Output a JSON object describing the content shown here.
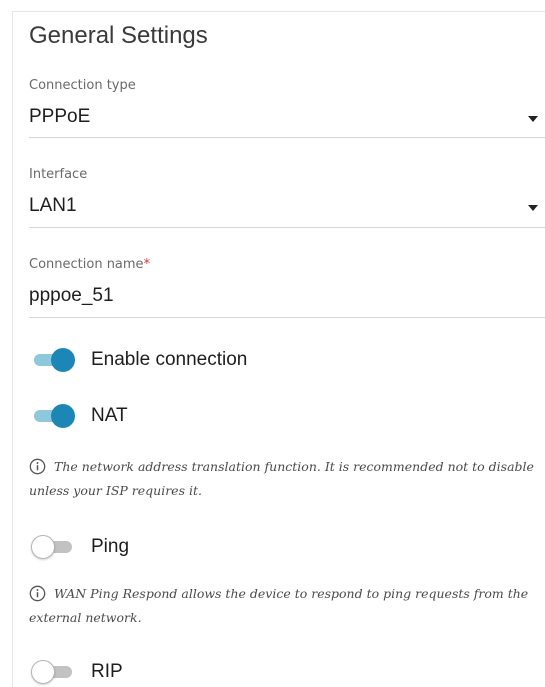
{
  "section": {
    "title": "General Settings"
  },
  "connection_type": {
    "label": "Connection type",
    "value": "PPPoE"
  },
  "interface": {
    "label": "Interface",
    "value": "LAN1"
  },
  "connection_name": {
    "label": "Connection name",
    "required_mark": "*",
    "value": "pppoe_51"
  },
  "toggles": {
    "enable_connection": {
      "label": "Enable connection",
      "on": true
    },
    "nat": {
      "label": "NAT",
      "on": true
    },
    "ping": {
      "label": "Ping",
      "on": false
    },
    "rip": {
      "label": "RIP",
      "on": false
    }
  },
  "hints": {
    "nat": "The network address translation function. It is recommended not to disable unless your ISP requires it.",
    "ping": "WAN Ping Respond allows the device to respond to ping requests from the external network."
  },
  "colors": {
    "accent": "#1c87b7",
    "accent_track": "#8ec8dc",
    "required": "#e0312f"
  },
  "icons": {
    "dropdown": "caret-down-icon",
    "info": "info-icon"
  }
}
